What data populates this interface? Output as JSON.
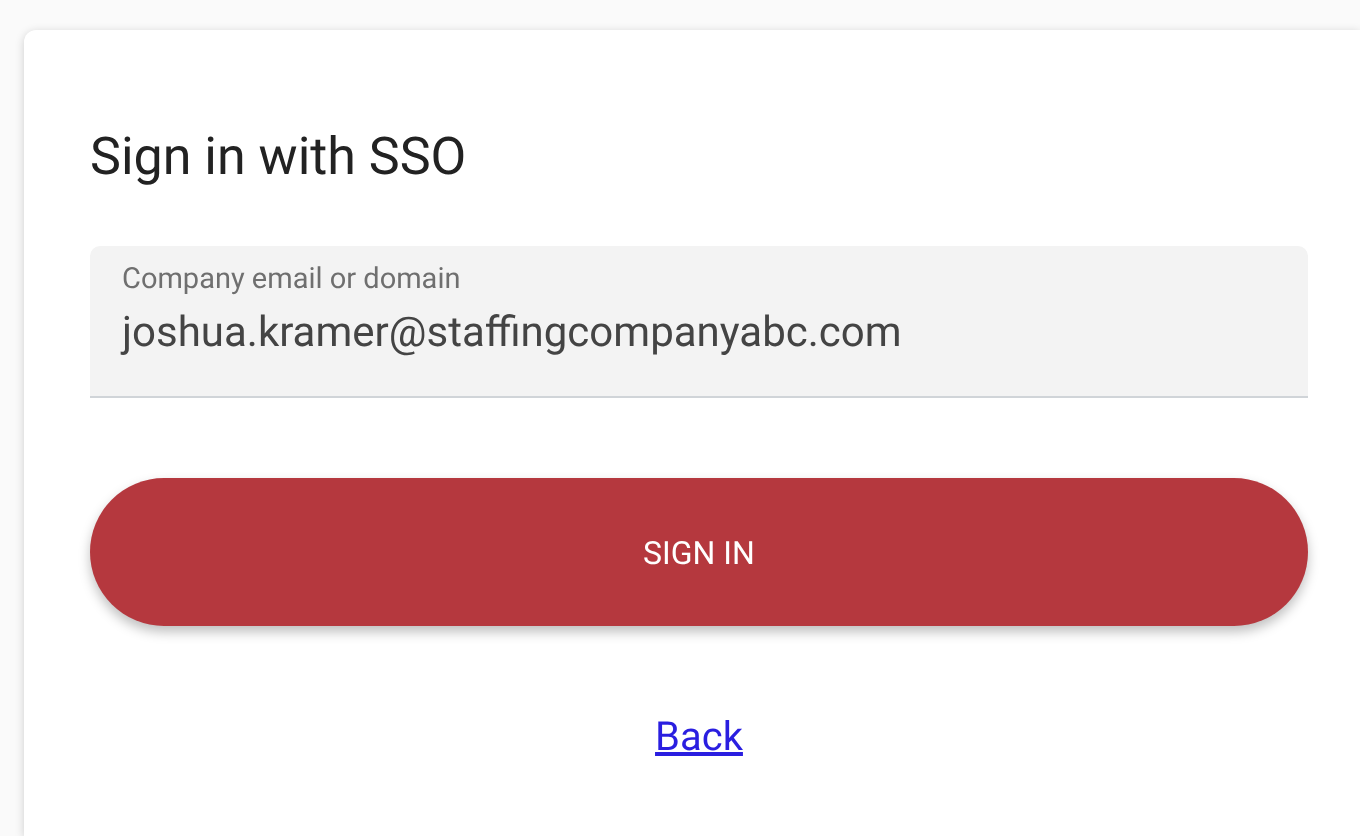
{
  "card": {
    "title": "Sign in with SSO",
    "field": {
      "label": "Company email or domain",
      "value": "joshua.kramer@staffingcompanyabc.com"
    },
    "button": {
      "label": "SIGN IN"
    },
    "link": {
      "label": "Back"
    }
  }
}
